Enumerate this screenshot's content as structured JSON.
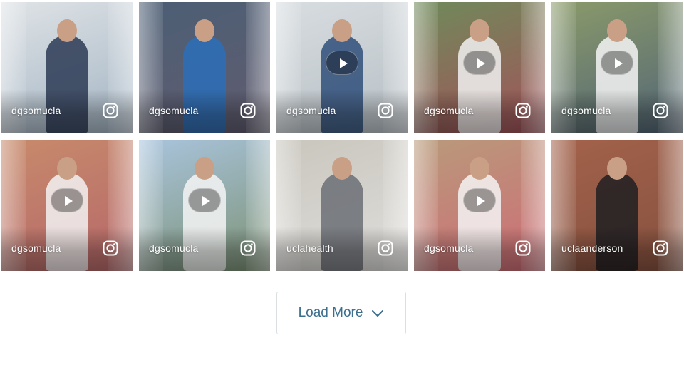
{
  "feed": {
    "tiles": [
      {
        "handle": "dgsomucla",
        "video": false,
        "bg": "#dfe3e6",
        "accent": "#2b3a55",
        "alt_accent": "#8aa1b5",
        "icon": "instagram-icon"
      },
      {
        "handle": "dgsomucla",
        "video": false,
        "bg": "#4b5e74",
        "accent": "#2b6fb8",
        "alt_accent": "#6b5c6e",
        "icon": "instagram-icon"
      },
      {
        "handle": "dgsomucla",
        "video": true,
        "bg": "#d8dde0",
        "accent": "#2f4f7a",
        "alt_accent": "#a9b3ba",
        "icon": "instagram-icon"
      },
      {
        "handle": "dgsomucla",
        "video": true,
        "bg": "#6f8a5a",
        "accent": "#f1f1f1",
        "alt_accent": "#b83b5a",
        "icon": "instagram-icon"
      },
      {
        "handle": "dgsomucla",
        "video": true,
        "bg": "#8a9a6a",
        "accent": "#f4f4f4",
        "alt_accent": "#3b4f7a",
        "icon": "instagram-icon"
      },
      {
        "handle": "dgsomucla",
        "video": true,
        "bg": "#c78a6b",
        "accent": "#f2f2f2",
        "alt_accent": "#b05a6a",
        "icon": "instagram-icon"
      },
      {
        "handle": "dgsomucla",
        "video": true,
        "bg": "#a9c4dd",
        "accent": "#f4f4f4",
        "alt_accent": "#6a7d4a",
        "icon": "instagram-icon"
      },
      {
        "handle": "uclahealth",
        "video": false,
        "bg": "#c9c6bd",
        "accent": "#6b6f75",
        "alt_accent": "#e8e8e8",
        "icon": "instagram-icon"
      },
      {
        "handle": "dgsomucla",
        "video": true,
        "bg": "#b99a7b",
        "accent": "#f4f4f4",
        "alt_accent": "#d65a74",
        "icon": "instagram-icon"
      },
      {
        "handle": "uclaanderson",
        "video": false,
        "bg": "#a3624b",
        "accent": "#1e1e22",
        "alt_accent": "#7a4a3a",
        "icon": "instagram-icon"
      }
    ]
  },
  "load_more": {
    "label": "Load More",
    "icon": "chevron-down-icon",
    "color": "#3a6f8f"
  }
}
